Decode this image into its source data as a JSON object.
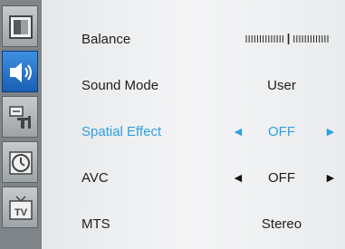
{
  "sidebar": {
    "items": [
      {
        "icon": "picture-icon",
        "active": false
      },
      {
        "icon": "sound-icon",
        "active": true
      },
      {
        "icon": "setup-icon",
        "active": false
      },
      {
        "icon": "clock-icon",
        "active": false
      },
      {
        "icon": "tv-icon",
        "active": false
      }
    ]
  },
  "menu": {
    "rows": [
      {
        "label": "Balance",
        "value": "",
        "control": "balance-bar",
        "balance_position": 0.5
      },
      {
        "label": "Sound Mode",
        "value": "User",
        "control": "text"
      },
      {
        "label": "Spatial Effect",
        "value": "OFF",
        "control": "arrows",
        "selected": true
      },
      {
        "label": "AVC",
        "value": "OFF",
        "control": "arrows"
      },
      {
        "label": "MTS",
        "value": "Stereo",
        "control": "text"
      }
    ],
    "arrow_left_glyph": "◄",
    "arrow_right_glyph": "►"
  },
  "colors": {
    "highlight": "#2e9fe0",
    "active_tab": "#1a5fb5",
    "panel": "#eef0f1",
    "sidebar": "#7e8488"
  }
}
